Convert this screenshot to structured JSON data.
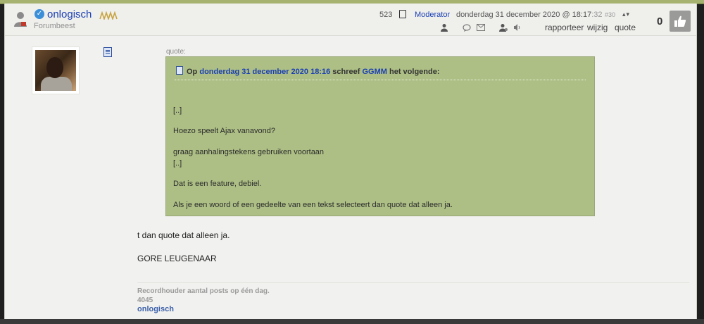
{
  "post": {
    "author": {
      "name": "onlogisch",
      "title": "Forumbeest"
    },
    "meta": {
      "post_count": "523",
      "role": "Moderator",
      "date_main": "donderdag 31 december 2020 @ 18:17",
      "date_seconds": ":32",
      "post_number": "#30"
    },
    "actions": {
      "report": "rapporteer",
      "edit": "wijzig",
      "quote": "quote"
    },
    "score": "0",
    "quote": {
      "label": "quote:",
      "header_prefix": "Op",
      "header_date": "donderdag 31 december 2020 18:16",
      "header_mid": "schreef",
      "header_author": "GGMM",
      "header_suffix": "het volgende:",
      "lines": [
        "[..]",
        "Hoezo speelt Ajax vanavond?",
        "graag aanhalingstekens gebruiken voortaan",
        "[..]",
        "Dat is een feature, debiel.",
        "Als je een woord of een gedeelte van een tekst selecteert dan quote dat alleen ja."
      ]
    },
    "body": [
      "t dan quote dat alleen ja.",
      "GORE LEUGENAAR"
    ],
    "signature": {
      "line1": "Recordhouder aantal posts op één dag.",
      "line2": "4045",
      "name": "onlogisch"
    }
  },
  "colors": {
    "quote_bg": "#adbf85",
    "link": "#1b3fb4",
    "like_button": "#9a9a98"
  },
  "icons": [
    "user-icon",
    "verified-icon",
    "rank-icon",
    "doc-icon",
    "sort-icon",
    "profile-icon",
    "message-icon",
    "mail-icon",
    "user-admin-icon",
    "speaker-icon",
    "thumbs-up-icon",
    "notes-icon"
  ]
}
